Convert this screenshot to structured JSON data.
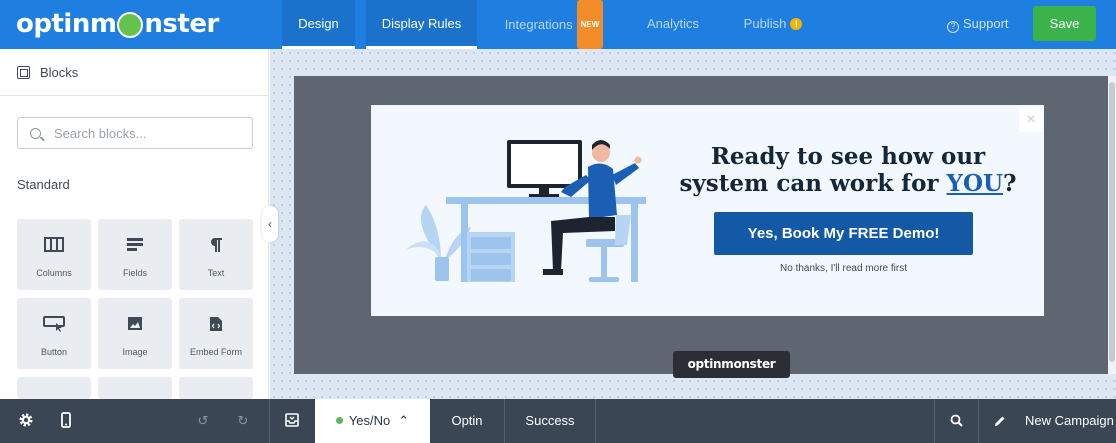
{
  "app": {
    "logo_text_left": "optinm",
    "logo_text_right": "nster"
  },
  "topnav": {
    "tabs": [
      {
        "label": "Design"
      },
      {
        "label": "Display Rules"
      },
      {
        "label": "Integrations",
        "badge": "NEW"
      },
      {
        "label": "Analytics"
      },
      {
        "label": "Publish",
        "badge": "!"
      }
    ],
    "support_label": "Support",
    "save_label": "Save"
  },
  "sidebar": {
    "header": "Blocks",
    "search_placeholder": "Search blocks...",
    "section_title": "Standard",
    "blocks": [
      {
        "label": "Columns",
        "icon": "columns-icon"
      },
      {
        "label": "Fields",
        "icon": "fields-icon"
      },
      {
        "label": "Text",
        "icon": "paragraph-icon"
      },
      {
        "label": "Button",
        "icon": "button-icon"
      },
      {
        "label": "Image",
        "icon": "image-icon"
      },
      {
        "label": "Embed Form",
        "icon": "embed-form-icon"
      }
    ]
  },
  "popup": {
    "headline_line1": "Ready to see how our",
    "headline_line2": "system can work for ",
    "headline_emph": "YOU",
    "headline_end": "?",
    "cta_label": "Yes, Book My FREE Demo!",
    "decline_label": "No thanks, I'll read more first",
    "close_symbol": "×",
    "badge_text": "optinmonster"
  },
  "bottombar": {
    "view_tabs": [
      {
        "label": "Yes/No",
        "status_color": "#5cb85c"
      },
      {
        "label": "Optin"
      },
      {
        "label": "Success"
      }
    ],
    "campaign_name": "New Campaign"
  },
  "colors": {
    "topbar": "#1f7fe0",
    "save": "#3bb24a",
    "cta": "#1459a6",
    "bottombar": "#3b4654"
  }
}
